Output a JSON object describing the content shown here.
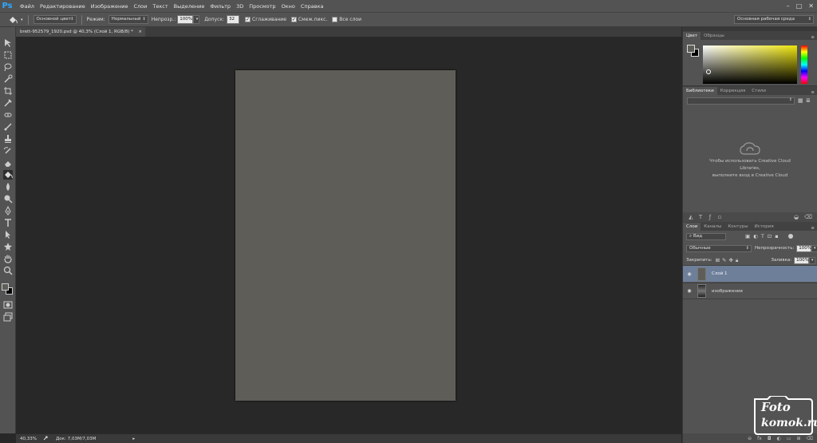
{
  "app": {
    "logo": "Ps"
  },
  "menu": [
    "Файл",
    "Редактирование",
    "Изображение",
    "Слои",
    "Текст",
    "Выделение",
    "Фильтр",
    "3D",
    "Просмотр",
    "Окно",
    "Справка"
  ],
  "window_controls": {
    "minimize": "–",
    "maximize": "□",
    "close": "✕"
  },
  "options": {
    "fill_source": "Основной цвет",
    "mode_label": "Режим:",
    "mode_value": "Нормальный",
    "opacity_label": "Непрозр.:",
    "opacity_value": "100%",
    "tolerance_label": "Допуск:",
    "tolerance_value": "32",
    "antialias": "Сглаживание",
    "contiguous": "Смеж.пикс.",
    "all_layers": "Все слои",
    "workspace": "Основная рабочая среда"
  },
  "document": {
    "tab_title": "brett-952579_1920.psd @ 40,3% (Слой 1, RGB/8) *",
    "tab_close": "×",
    "fill_color": "#5f5d57"
  },
  "status": {
    "zoom": "40,33%",
    "doc_info": "Док: 7,03M/7,03M",
    "arrow": "▸"
  },
  "color_panel": {
    "tabs": [
      "Цвет",
      "Образцы"
    ],
    "fg_color": "#5f5d57",
    "bg_color": "#000000"
  },
  "libraries_panel": {
    "tabs": [
      "Библиотеки",
      "Коррекция",
      "Стили"
    ],
    "message_line1": "Чтобы использовать Creative Cloud",
    "message_line2": "Libraries,",
    "message_line3": "выполните вход в Creative Cloud"
  },
  "layers_panel": {
    "tabs": [
      "Слои",
      "Каналы",
      "Контуры",
      "История"
    ],
    "filter_kind": "Вид",
    "blend_mode": "Обычные",
    "opacity_label": "Непрозрачность:",
    "opacity_value": "100%",
    "lock_label": "Закрепить:",
    "fill_label": "Заливка:",
    "fill_value": "100%",
    "layers": [
      {
        "name": "Слой 1"
      },
      {
        "name": "изображение"
      }
    ]
  },
  "watermark": {
    "line1": "Foto",
    "line2": "komok.ru"
  }
}
